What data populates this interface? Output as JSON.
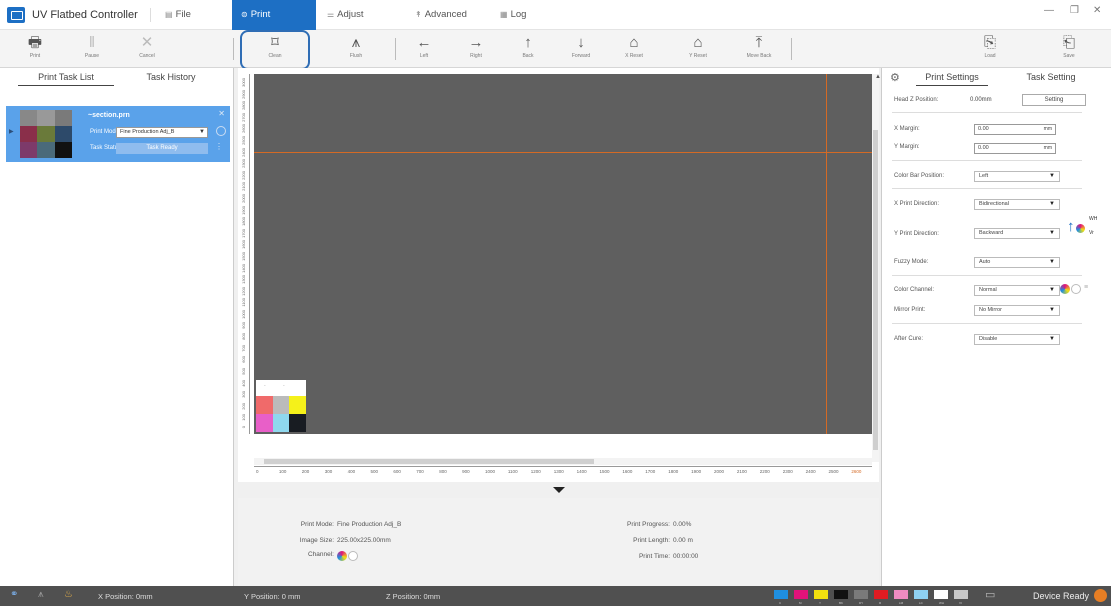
{
  "app": {
    "title": "UV Flatbed Controller"
  },
  "menu": {
    "file": "File",
    "print": "Print",
    "adjust": "Adjust",
    "advanced": "Advanced",
    "log": "Log"
  },
  "toolbar": {
    "print": "Print",
    "pause": "Pause",
    "cancel": "Cancel",
    "clean": "Clean",
    "flush": "Flush",
    "left": "Left",
    "right": "Right",
    "back": "Back",
    "forward": "Forward",
    "x_reset": "X Reset",
    "y_reset": "Y Reset",
    "move_back": "Move Back",
    "load": "Load",
    "save": "Save"
  },
  "left_panel": {
    "tabs": [
      "Print Task List",
      "Task History"
    ],
    "task": {
      "name": "~section.prn",
      "print_mode_label": "Print Mode",
      "print_mode_value": "Fine Production Adj_B",
      "status_label": "Task Status",
      "status_value": "Task Ready"
    }
  },
  "canvas": {
    "vruler_ticks": [
      "3000",
      "2900",
      "2800",
      "2700",
      "2600",
      "2500",
      "2400",
      "2300",
      "2200",
      "2100",
      "2000",
      "1900",
      "1800",
      "1700",
      "1600",
      "1500",
      "1400",
      "1300",
      "1200",
      "1100",
      "1000",
      "900",
      "800",
      "700",
      "600",
      "500",
      "400",
      "300",
      "200",
      "100",
      "0"
    ],
    "hruler_ticks": [
      "0",
      "100",
      "200",
      "300",
      "400",
      "500",
      "600",
      "700",
      "800",
      "900",
      "1000",
      "1100",
      "1200",
      "1300",
      "1400",
      "1500",
      "1600",
      "1700",
      "1800",
      "1900",
      "2000",
      "2100",
      "2200",
      "2300",
      "2400",
      "2500",
      "2600"
    ],
    "guide_color": "#d46a25",
    "canvas_color": "#5f5f5f"
  },
  "info": {
    "print_mode_label": "Print Mode:",
    "print_mode_value": "Fine Production Adj_B",
    "image_size_label": "Image Size:",
    "image_size_value": "225.00x225.00mm",
    "channel_label": "Channel:",
    "progress_label": "Print Progress:",
    "progress_value": "0.00%",
    "length_label": "Print Length:",
    "length_value": "0.00 m",
    "time_label": "Print Time:",
    "time_value": "00:00:00"
  },
  "right_panel": {
    "tabs": [
      "Print Settings",
      "Task Setting"
    ],
    "head_z_label": "Head Z Position:",
    "head_z_value": "0.00mm",
    "setting_button": "Setting",
    "x_margin_label": "X Margin:",
    "x_margin_value": "0.00",
    "y_margin_label": "Y Margin:",
    "y_margin_value": "0.00",
    "unit": "mm",
    "color_bar_label": "Color Bar Position:",
    "color_bar_value": "Left",
    "x_dir_label": "X Print Direction:",
    "x_dir_value": "Bidirectional",
    "y_dir_label": "Y Print Direction:",
    "y_dir_value": "Backward",
    "fuzzy_label": "Fuzzy Mode:",
    "fuzzy_value": "Auto",
    "channel_label": "Color Channel:",
    "channel_value": "Normal",
    "mirror_label": "Mirror Print:",
    "mirror_value": "No Mirror",
    "cure_label": "After Cure:",
    "cure_value": "Disable",
    "wh_label": "WH",
    "vr_label": "Vr"
  },
  "status": {
    "x_pos": "X Position: 0mm",
    "y_pos": "Y Position: 0 mm",
    "z_pos": "Z Position: 0mm",
    "device_state": "Device Ready",
    "inks": [
      {
        "label": "C",
        "color": "#1f8fe0"
      },
      {
        "label": "M",
        "color": "#e2137a"
      },
      {
        "label": "Y",
        "color": "#f3e10f"
      },
      {
        "label": "BK",
        "color": "#111111"
      },
      {
        "label": "DY",
        "color": "#7a7a7a"
      },
      {
        "label": "R",
        "color": "#e11b22"
      },
      {
        "label": "LM",
        "color": "#f08bc1"
      },
      {
        "label": "LC",
        "color": "#8fd1f2"
      },
      {
        "label": "WH",
        "color": "#ffffff"
      },
      {
        "label": "VI",
        "color": "#c8c8c8"
      }
    ]
  }
}
